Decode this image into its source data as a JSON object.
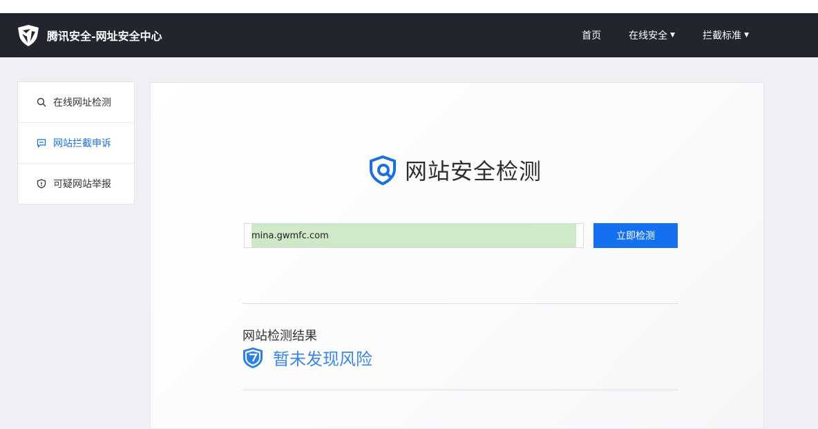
{
  "header": {
    "brand_title": "腾讯安全-网址安全中心",
    "nav": [
      {
        "label": "首页"
      },
      {
        "label": "在线安全"
      },
      {
        "label": "拦截标准"
      }
    ]
  },
  "sidebar": {
    "items": [
      {
        "label": "在线网址检测",
        "icon": "search-icon"
      },
      {
        "label": "网站拦截申诉",
        "icon": "message-icon",
        "active": true
      },
      {
        "label": "可疑网站举报",
        "icon": "shield-icon"
      }
    ]
  },
  "main": {
    "title": "网站安全检测",
    "url_input": {
      "value": "mina.gwmfc.com"
    },
    "check_button": "立即检测",
    "result_label": "网站检测结果",
    "result_text": "暂未发现风险"
  },
  "colors": {
    "navbar_bg": "#23252e",
    "accent": "#1570ef",
    "active_link": "#1a6fe0",
    "result_blue": "#3a86e8",
    "input_highlight": "#cfe8c8"
  }
}
